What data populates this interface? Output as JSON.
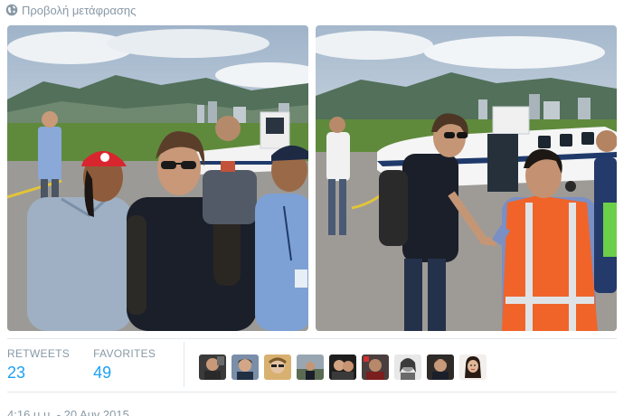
{
  "translate": {
    "label": "Προβολή μετάφρασης",
    "icon": "globe-icon"
  },
  "photos": [
    {
      "name": "photo-left"
    },
    {
      "name": "photo-right"
    }
  ],
  "stats": {
    "retweets_label": "RETWEETS",
    "retweets_value": "23",
    "favorites_label": "FAVORITES",
    "favorites_value": "49"
  },
  "favorited_by": [
    {
      "avatar": "avatar-1"
    },
    {
      "avatar": "avatar-2"
    },
    {
      "avatar": "avatar-3"
    },
    {
      "avatar": "avatar-4"
    },
    {
      "avatar": "avatar-5"
    },
    {
      "avatar": "avatar-6"
    },
    {
      "avatar": "avatar-7"
    },
    {
      "avatar": "avatar-8"
    },
    {
      "avatar": "avatar-9"
    }
  ],
  "timestamp": "4:16 μ.μ. - 20 Αυγ 2015",
  "colors": {
    "link": "#1da1f2",
    "muted": "#8899a6",
    "border": "#e1e8ed"
  }
}
